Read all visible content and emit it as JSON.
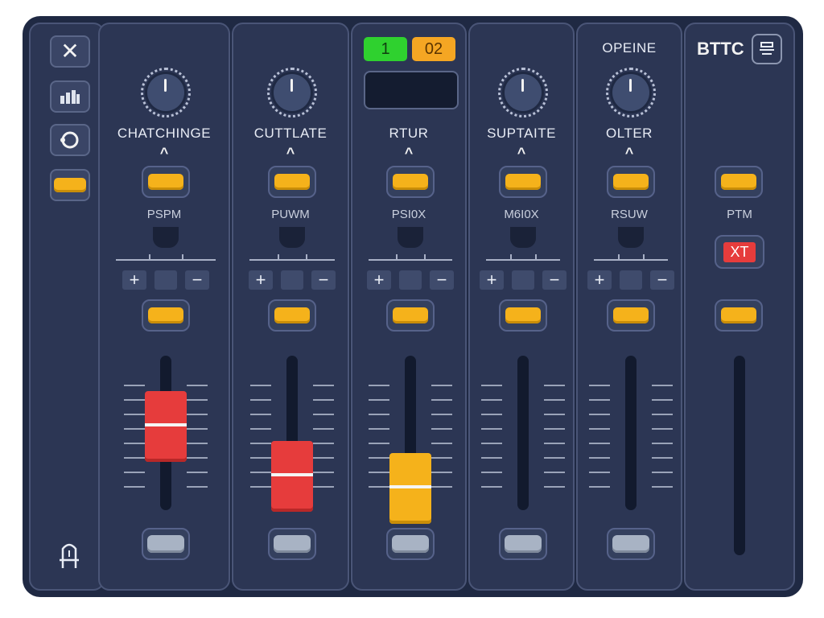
{
  "sidebar": {
    "icons": [
      "close-icon",
      "grid-icon",
      "refresh-icon"
    ],
    "bottom_icon": "pin-icon"
  },
  "channels": [
    {
      "label": "CHATCHINGE",
      "sublabel": "PSPM"
    },
    {
      "label": "CUTTLATE",
      "sublabel": "PUWM"
    },
    {
      "label": "RTUR",
      "sublabel": "PSI0X",
      "badge1": "1",
      "badge2": "02"
    },
    {
      "label": "SUPTAITE",
      "sublabel": "M6I0X"
    },
    {
      "label": "OLTER",
      "sublabel": "RSUW",
      "header": "OPEINE"
    }
  ],
  "master": {
    "title": "BTTC",
    "sublabel": "PTM",
    "alert": "XT"
  },
  "faders": [
    {
      "channel": "CHATCHINGE",
      "level": 0.65,
      "color": "red"
    },
    {
      "channel": "CUTTLATE",
      "level": 0.25,
      "color": "red"
    },
    {
      "channel": "RTUR",
      "level": 0.15,
      "color": "amber"
    }
  ],
  "colors": {
    "accent": "#f5b21b",
    "fader_red": "#e63c3c",
    "badge_green": "#2fd12f",
    "badge_orange": "#f5a623",
    "alert_red": "#e63c3c",
    "panel": "#2c3654"
  }
}
